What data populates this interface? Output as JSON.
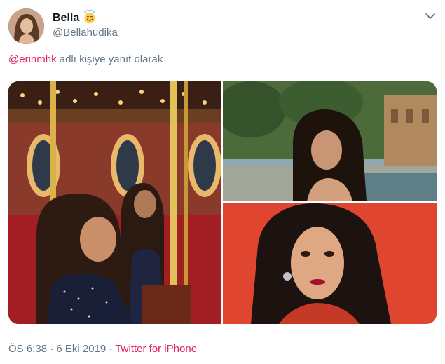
{
  "user": {
    "display_name": "Bella",
    "handle": "@Bellahudika",
    "badge_icon": "angel-emoji-icon"
  },
  "reply": {
    "mention": "@erinmhk",
    "suffix": " adlı kişiye yanıt olarak"
  },
  "media": {
    "images": [
      "carousel-photo",
      "park-portrait-photo",
      "red-background-portrait-photo"
    ]
  },
  "meta": {
    "timestamp": "ÖS 6:38 · 6 Eki 2019",
    "separator": " · ",
    "source": "Twitter for iPhone"
  },
  "colors": {
    "accent": "#e0245e",
    "muted": "#657786",
    "text": "#14171a"
  }
}
